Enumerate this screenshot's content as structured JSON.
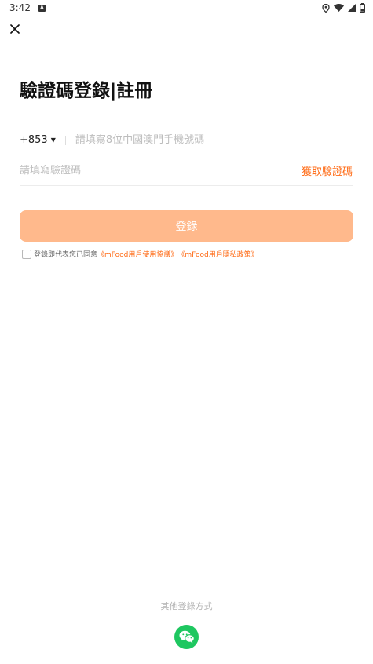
{
  "status_bar": {
    "time": "3:42",
    "notification_icon": "a-icon",
    "icons": [
      "location-icon",
      "wifi-icon",
      "signal-icon",
      "battery-icon"
    ]
  },
  "header": {
    "close_icon": "close-icon"
  },
  "title": "驗證碼登錄|註冊",
  "phone": {
    "country_code": "+853",
    "placeholder": "請填寫8位中國澳門手機號碼",
    "value": ""
  },
  "code": {
    "placeholder": "請填寫驗證碼",
    "value": "",
    "get_code_label": "獲取驗證碼"
  },
  "login": {
    "label": "登錄"
  },
  "agreement": {
    "checked": false,
    "prefix": "登錄即代表您已同意",
    "user_agreement": "《mFood用戶使用協議》",
    "privacy_policy": "《mFood用戶隱私政策》"
  },
  "other_login": {
    "label": "其他登錄方式",
    "wechat_icon": "wechat-icon"
  },
  "colors": {
    "accent": "#ff6a14",
    "button_disabled": "#ffb98c",
    "wechat": "#1ec760",
    "placeholder": "#bdbdbd"
  }
}
